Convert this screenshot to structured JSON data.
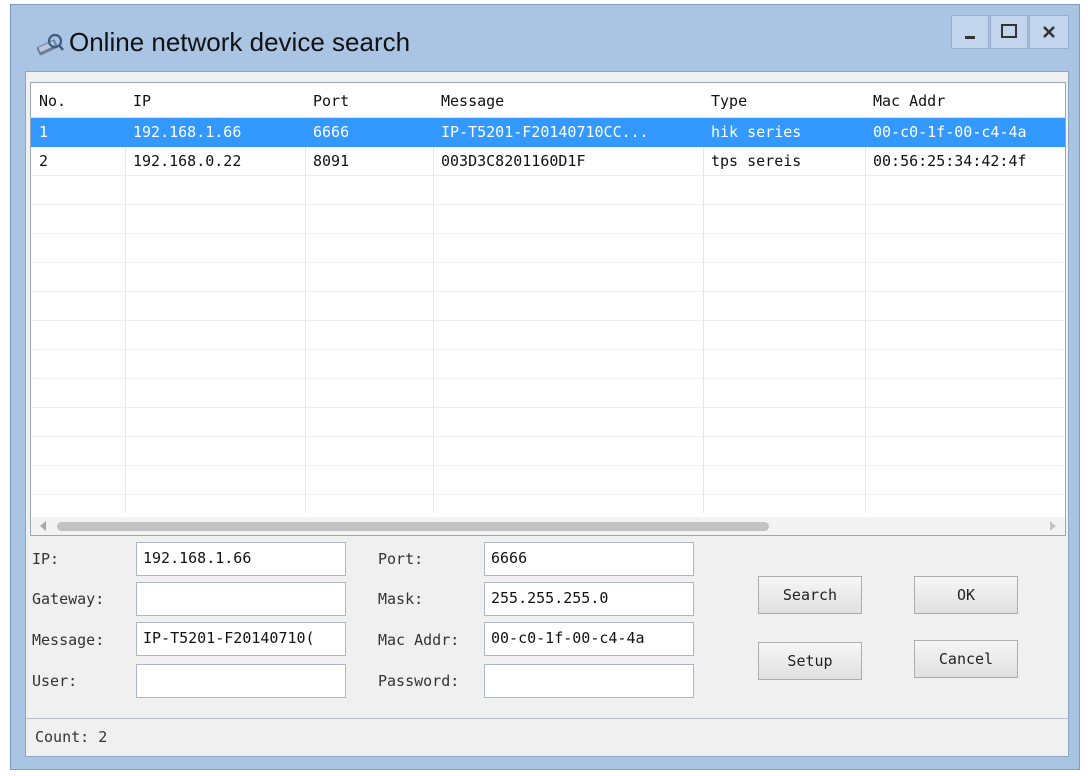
{
  "window": {
    "title": "Online network device search",
    "controls": {
      "minimize": "minimize",
      "maximize": "maximize",
      "close": "close"
    }
  },
  "table": {
    "columns": [
      "No.",
      "IP",
      "Port",
      "Message",
      "Type",
      "Mac Addr"
    ],
    "rows": [
      {
        "no": "1",
        "ip": "192.168.1.66",
        "port": "6666",
        "message": "IP-T5201-F20140710CC...",
        "type": "hik series",
        "mac": "00-c0-1f-00-c4-4a",
        "selected": true
      },
      {
        "no": "2",
        "ip": "192.168.0.22",
        "port": "8091",
        "message": "003D3C8201160D1F",
        "type": "tps sereis",
        "mac": "00:56:25:34:42:4f",
        "selected": false
      }
    ]
  },
  "form": {
    "ip_label": "IP:",
    "ip_value": "192.168.1.66",
    "gateway_label": "Gateway:",
    "gateway_value": "",
    "message_label": "Message:",
    "message_value": "IP-T5201-F20140710(",
    "user_label": "User:",
    "user_value": "",
    "port_label": "Port:",
    "port_value": "6666",
    "mask_label": "Mask:",
    "mask_value": "255.255.255.0",
    "mac_label": "Mac Addr:",
    "mac_value": "00-c0-1f-00-c4-4a",
    "password_label": "Password:",
    "password_value": ""
  },
  "buttons": {
    "search": "Search",
    "ok": "OK",
    "setup": "Setup",
    "cancel": "Cancel"
  },
  "status": {
    "count": "Count: 2"
  },
  "colors": {
    "window_frame": "#aac4e3",
    "selection": "#3399ff"
  }
}
